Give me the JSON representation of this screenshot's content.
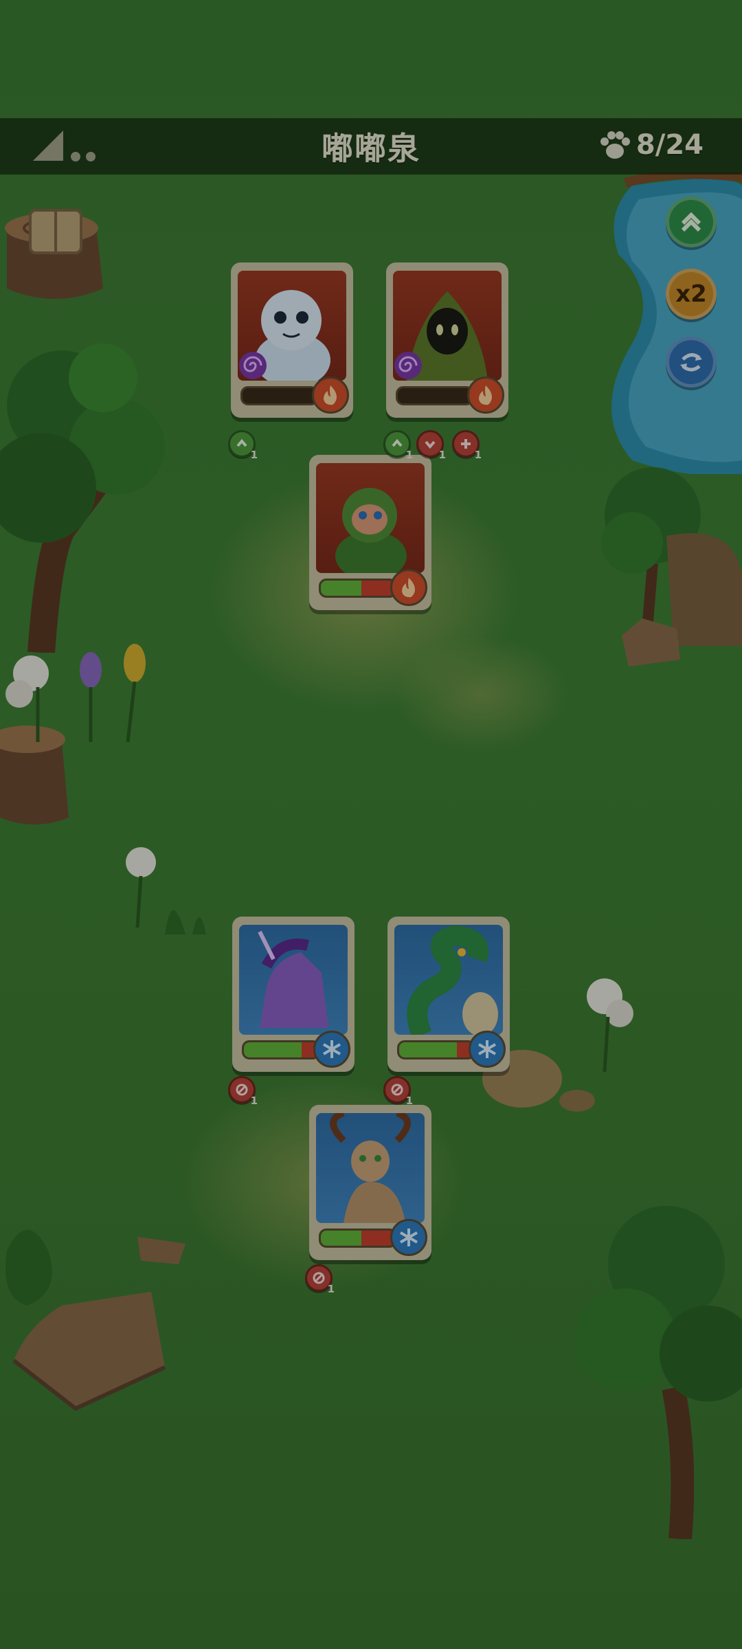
{
  "header": {
    "title": "嘟嘟泉",
    "counter": "8/24"
  },
  "side_buttons": {
    "x2_label": "x2"
  },
  "colors": {
    "hp_enemy": "#c4402e",
    "hp_ally": "#62b53a",
    "fire": "#d0502a",
    "ice": "#2d7cc0"
  },
  "enemies": [
    {
      "name": "snow-tiger-cub",
      "hp": 0.0,
      "element": "fire",
      "status": "purple-swirl"
    },
    {
      "name": "hooded-mask-figure",
      "hp": 0.0,
      "element": "fire",
      "status": "purple-swirl"
    },
    {
      "name": "green-monkey",
      "hp": 0.45,
      "element": "fire"
    }
  ],
  "allies": [
    {
      "name": "purple-unicorn",
      "hp": 0.78,
      "element": "ice"
    },
    {
      "name": "green-serpent",
      "hp": 0.78,
      "element": "ice"
    },
    {
      "name": "horned-antelope",
      "hp": 0.55,
      "element": "ice"
    }
  ],
  "badges": {
    "count_1": "1"
  }
}
